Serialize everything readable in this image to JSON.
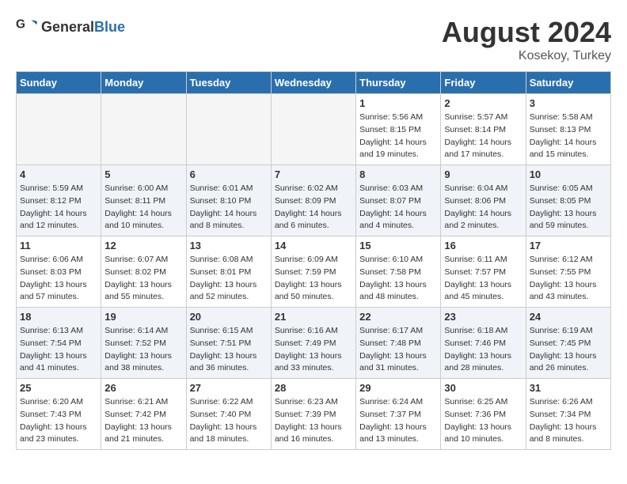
{
  "header": {
    "logo_general": "General",
    "logo_blue": "Blue",
    "month_year": "August 2024",
    "location": "Kosekoy, Turkey"
  },
  "days_of_week": [
    "Sunday",
    "Monday",
    "Tuesday",
    "Wednesday",
    "Thursday",
    "Friday",
    "Saturday"
  ],
  "weeks": [
    [
      {
        "day": "",
        "info": ""
      },
      {
        "day": "",
        "info": ""
      },
      {
        "day": "",
        "info": ""
      },
      {
        "day": "",
        "info": ""
      },
      {
        "day": "1",
        "info": "Sunrise: 5:56 AM\nSunset: 8:15 PM\nDaylight: 14 hours\nand 19 minutes."
      },
      {
        "day": "2",
        "info": "Sunrise: 5:57 AM\nSunset: 8:14 PM\nDaylight: 14 hours\nand 17 minutes."
      },
      {
        "day": "3",
        "info": "Sunrise: 5:58 AM\nSunset: 8:13 PM\nDaylight: 14 hours\nand 15 minutes."
      }
    ],
    [
      {
        "day": "4",
        "info": "Sunrise: 5:59 AM\nSunset: 8:12 PM\nDaylight: 14 hours\nand 12 minutes."
      },
      {
        "day": "5",
        "info": "Sunrise: 6:00 AM\nSunset: 8:11 PM\nDaylight: 14 hours\nand 10 minutes."
      },
      {
        "day": "6",
        "info": "Sunrise: 6:01 AM\nSunset: 8:10 PM\nDaylight: 14 hours\nand 8 minutes."
      },
      {
        "day": "7",
        "info": "Sunrise: 6:02 AM\nSunset: 8:09 PM\nDaylight: 14 hours\nand 6 minutes."
      },
      {
        "day": "8",
        "info": "Sunrise: 6:03 AM\nSunset: 8:07 PM\nDaylight: 14 hours\nand 4 minutes."
      },
      {
        "day": "9",
        "info": "Sunrise: 6:04 AM\nSunset: 8:06 PM\nDaylight: 14 hours\nand 2 minutes."
      },
      {
        "day": "10",
        "info": "Sunrise: 6:05 AM\nSunset: 8:05 PM\nDaylight: 13 hours\nand 59 minutes."
      }
    ],
    [
      {
        "day": "11",
        "info": "Sunrise: 6:06 AM\nSunset: 8:03 PM\nDaylight: 13 hours\nand 57 minutes."
      },
      {
        "day": "12",
        "info": "Sunrise: 6:07 AM\nSunset: 8:02 PM\nDaylight: 13 hours\nand 55 minutes."
      },
      {
        "day": "13",
        "info": "Sunrise: 6:08 AM\nSunset: 8:01 PM\nDaylight: 13 hours\nand 52 minutes."
      },
      {
        "day": "14",
        "info": "Sunrise: 6:09 AM\nSunset: 7:59 PM\nDaylight: 13 hours\nand 50 minutes."
      },
      {
        "day": "15",
        "info": "Sunrise: 6:10 AM\nSunset: 7:58 PM\nDaylight: 13 hours\nand 48 minutes."
      },
      {
        "day": "16",
        "info": "Sunrise: 6:11 AM\nSunset: 7:57 PM\nDaylight: 13 hours\nand 45 minutes."
      },
      {
        "day": "17",
        "info": "Sunrise: 6:12 AM\nSunset: 7:55 PM\nDaylight: 13 hours\nand 43 minutes."
      }
    ],
    [
      {
        "day": "18",
        "info": "Sunrise: 6:13 AM\nSunset: 7:54 PM\nDaylight: 13 hours\nand 41 minutes."
      },
      {
        "day": "19",
        "info": "Sunrise: 6:14 AM\nSunset: 7:52 PM\nDaylight: 13 hours\nand 38 minutes."
      },
      {
        "day": "20",
        "info": "Sunrise: 6:15 AM\nSunset: 7:51 PM\nDaylight: 13 hours\nand 36 minutes."
      },
      {
        "day": "21",
        "info": "Sunrise: 6:16 AM\nSunset: 7:49 PM\nDaylight: 13 hours\nand 33 minutes."
      },
      {
        "day": "22",
        "info": "Sunrise: 6:17 AM\nSunset: 7:48 PM\nDaylight: 13 hours\nand 31 minutes."
      },
      {
        "day": "23",
        "info": "Sunrise: 6:18 AM\nSunset: 7:46 PM\nDaylight: 13 hours\nand 28 minutes."
      },
      {
        "day": "24",
        "info": "Sunrise: 6:19 AM\nSunset: 7:45 PM\nDaylight: 13 hours\nand 26 minutes."
      }
    ],
    [
      {
        "day": "25",
        "info": "Sunrise: 6:20 AM\nSunset: 7:43 PM\nDaylight: 13 hours\nand 23 minutes."
      },
      {
        "day": "26",
        "info": "Sunrise: 6:21 AM\nSunset: 7:42 PM\nDaylight: 13 hours\nand 21 minutes."
      },
      {
        "day": "27",
        "info": "Sunrise: 6:22 AM\nSunset: 7:40 PM\nDaylight: 13 hours\nand 18 minutes."
      },
      {
        "day": "28",
        "info": "Sunrise: 6:23 AM\nSunset: 7:39 PM\nDaylight: 13 hours\nand 16 minutes."
      },
      {
        "day": "29",
        "info": "Sunrise: 6:24 AM\nSunset: 7:37 PM\nDaylight: 13 hours\nand 13 minutes."
      },
      {
        "day": "30",
        "info": "Sunrise: 6:25 AM\nSunset: 7:36 PM\nDaylight: 13 hours\nand 10 minutes."
      },
      {
        "day": "31",
        "info": "Sunrise: 6:26 AM\nSunset: 7:34 PM\nDaylight: 13 hours\nand 8 minutes."
      }
    ]
  ]
}
